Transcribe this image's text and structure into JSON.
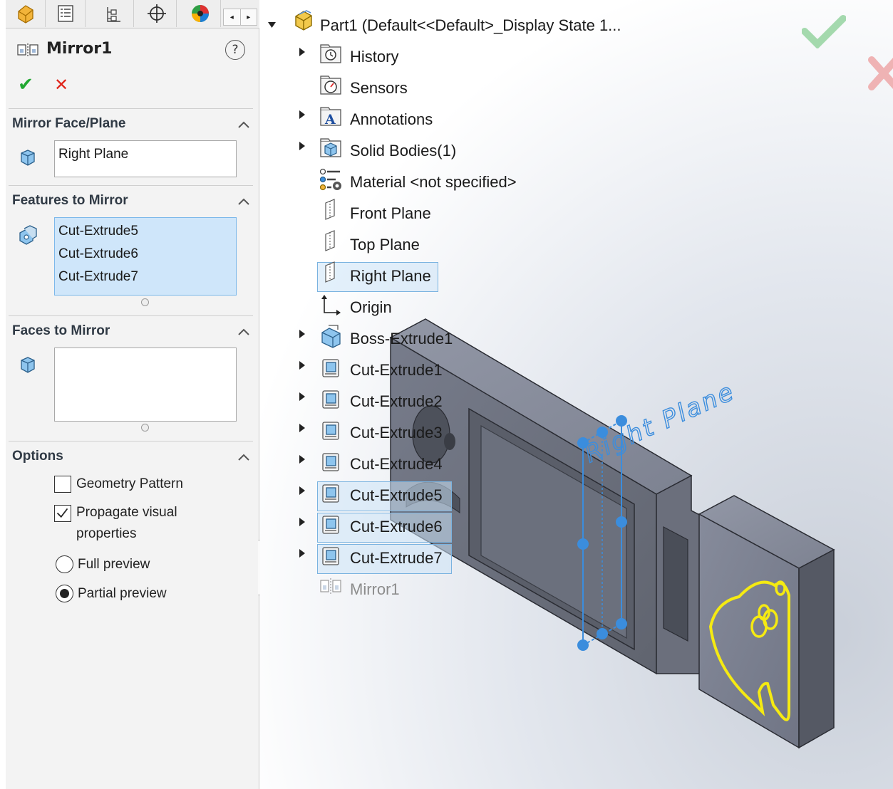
{
  "property_manager": {
    "title": "Mirror1",
    "help_label": "?",
    "ok_label": "✔",
    "cancel_label": "✕",
    "groups": {
      "mirror_face": {
        "title": "Mirror Face/Plane",
        "value": "Right Plane"
      },
      "features": {
        "title": "Features to Mirror",
        "items": [
          "Cut-Extrude5",
          "Cut-Extrude6",
          "Cut-Extrude7"
        ]
      },
      "faces": {
        "title": "Faces to Mirror",
        "items": []
      },
      "options": {
        "title": "Options",
        "geometry_pattern": {
          "label": "Geometry Pattern",
          "checked": false
        },
        "propagate": {
          "label_line1": "Propagate visual",
          "label_line2": "properties",
          "checked": true
        },
        "full_preview": {
          "label": "Full preview",
          "selected": false
        },
        "partial_preview": {
          "label": "Partial preview",
          "selected": true
        }
      }
    },
    "tab_scroll": {
      "left": "◂",
      "right": "▸"
    }
  },
  "tree": {
    "root": "Part1  (Default<<Default>_Display State 1...",
    "items": [
      {
        "label": "History",
        "icon": "history-icon",
        "expandable": true,
        "selected": false
      },
      {
        "label": "Sensors",
        "icon": "sensors-icon",
        "expandable": false,
        "selected": false
      },
      {
        "label": "Annotations",
        "icon": "annotations-icon",
        "expandable": true,
        "selected": false
      },
      {
        "label": "Solid Bodies(1)",
        "icon": "solid-bodies-icon",
        "expandable": true,
        "selected": false
      },
      {
        "label": "Material <not specified>",
        "icon": "material-icon",
        "expandable": false,
        "selected": false
      },
      {
        "label": "Front Plane",
        "icon": "plane-icon",
        "expandable": false,
        "selected": false
      },
      {
        "label": "Top Plane",
        "icon": "plane-icon",
        "expandable": false,
        "selected": false
      },
      {
        "label": "Right Plane",
        "icon": "plane-icon",
        "expandable": false,
        "selected": true
      },
      {
        "label": "Origin",
        "icon": "origin-icon",
        "expandable": false,
        "selected": false
      },
      {
        "label": "Boss-Extrude1",
        "icon": "boss-extrude-icon",
        "expandable": true,
        "selected": false
      },
      {
        "label": "Cut-Extrude1",
        "icon": "cut-extrude-icon",
        "expandable": true,
        "selected": false
      },
      {
        "label": "Cut-Extrude2",
        "icon": "cut-extrude-icon",
        "expandable": true,
        "selected": false
      },
      {
        "label": "Cut-Extrude3",
        "icon": "cut-extrude-icon",
        "expandable": true,
        "selected": false
      },
      {
        "label": "Cut-Extrude4",
        "icon": "cut-extrude-icon",
        "expandable": true,
        "selected": false
      },
      {
        "label": "Cut-Extrude5",
        "icon": "cut-extrude-icon",
        "expandable": true,
        "selected": true
      },
      {
        "label": "Cut-Extrude6",
        "icon": "cut-extrude-icon",
        "expandable": true,
        "selected": true
      },
      {
        "label": "Cut-Extrude7",
        "icon": "cut-extrude-icon",
        "expandable": true,
        "selected": true
      },
      {
        "label": "Mirror1",
        "icon": "mirror-icon",
        "expandable": false,
        "selected": false,
        "dimmed": true
      }
    ]
  },
  "viewport": {
    "plane_label": "Right Plane"
  },
  "colors": {
    "accent": "#3b8ddd",
    "ok_green": "#22a832",
    "cancel_red": "#e0251b",
    "model_body": "#6e7382",
    "highlight_yellow": "#f5ea12",
    "selection_bg": "#cfe6fa"
  }
}
